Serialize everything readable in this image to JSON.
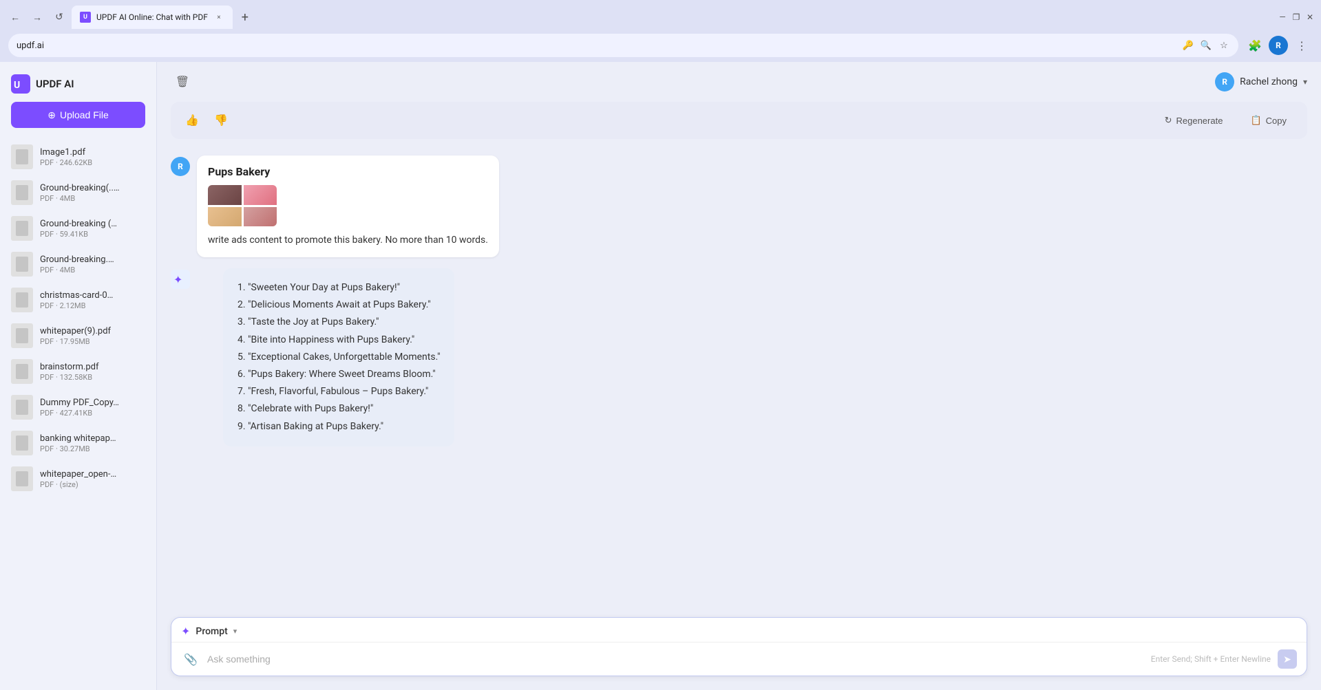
{
  "browser": {
    "tab": {
      "title": "UPDF AI Online: Chat with PDF",
      "favicon_text": "U",
      "close_label": "×",
      "new_tab_label": "+"
    },
    "address": "updf.ai",
    "window_controls": {
      "minimize": "—",
      "maximize": "❐",
      "close": "✕"
    },
    "back_icon": "←",
    "forward_icon": "→",
    "refresh_icon": "↺",
    "extensions_icon": "🧩",
    "zoom_icon": "🔍",
    "bookmark_icon": "☆",
    "more_icon": "⋮",
    "avatar_initial": "R"
  },
  "sidebar": {
    "title": "UPDF AI",
    "upload_label": "Upload File",
    "files": [
      {
        "name": "Image1.pdf",
        "size": "PDF · 246.62KB"
      },
      {
        "name": "Ground-breaking(..…",
        "size": "PDF · 4MB"
      },
      {
        "name": "Ground-breaking (…",
        "size": "PDF · 59.41KB"
      },
      {
        "name": "Ground-breaking.…",
        "size": "PDF · 4MB"
      },
      {
        "name": "christmas-card-0…",
        "size": "PDF · 2.12MB"
      },
      {
        "name": "whitepaper(9).pdf",
        "size": "PDF · 17.95MB"
      },
      {
        "name": "brainstorm.pdf",
        "size": "PDF · 132.58KB"
      },
      {
        "name": "Dummy PDF_Copy…",
        "size": "PDF · 427.41KB"
      },
      {
        "name": "banking whitepap…",
        "size": "PDF · 30.27MB"
      },
      {
        "name": "whitepaper_open-…",
        "size": "PDF · (size)"
      }
    ]
  },
  "main": {
    "delete_icon": "🗑",
    "user": {
      "name": "Rachel zhong",
      "initial": "R",
      "chevron": "▾"
    },
    "feedback": {
      "thumbs_up": "👍",
      "thumbs_down": "👎",
      "regenerate_label": "Regenerate",
      "copy_label": "Copy"
    },
    "user_message": {
      "user_initial": "R",
      "bakery_name": "Pups Bakery",
      "prompt_text": "write ads content to promote this bakery. No more than 10 words."
    },
    "ai_responses": [
      "\"Sweeten Your Day at Pups Bakery!\"",
      "\"Delicious Moments Await at Pups Bakery.\"",
      "\"Taste the Joy at Pups Bakery.\"",
      "\"Bite into Happiness with Pups Bakery.\"",
      "\"Exceptional Cakes, Unforgettable Moments.\"",
      "\"Pups Bakery: Where Sweet Dreams Bloom.\"",
      "\"Fresh, Flavorful, Fabulous – Pups Bakery.\"",
      "\"Celebrate with Pups Bakery!\"",
      "\"Artisan Baking at Pups Bakery.\""
    ],
    "input": {
      "prompt_label": "Prompt",
      "prompt_chevron": "▾",
      "placeholder": "Ask something",
      "hint": "Enter Send; Shift + Enter Newline",
      "attach_icon": "📎",
      "send_icon": "➤"
    }
  }
}
